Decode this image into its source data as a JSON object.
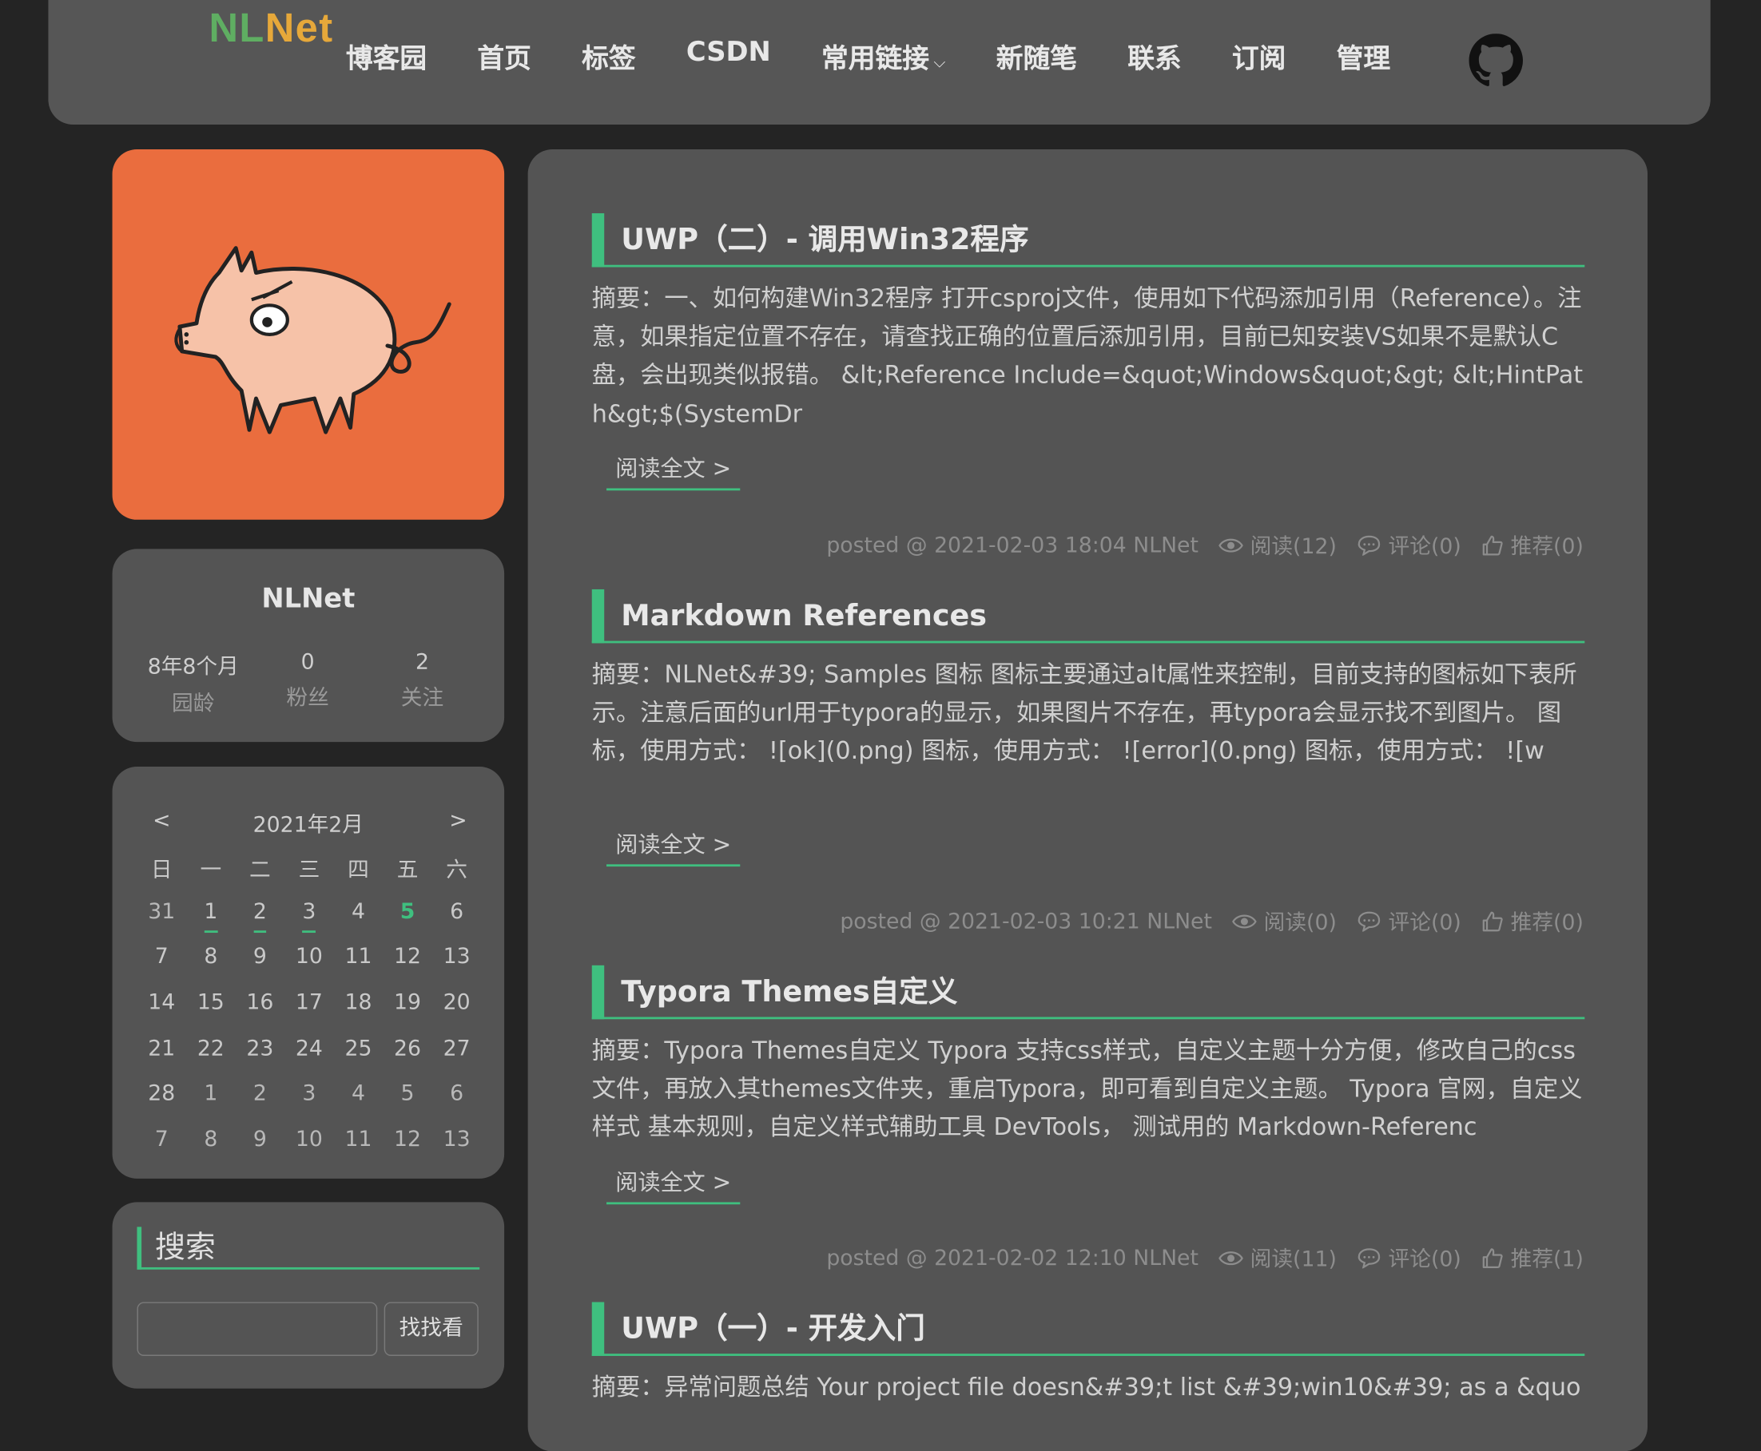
{
  "header": {
    "logo_part1": "NL",
    "logo_part2": "Net",
    "nav": [
      {
        "label": "博客园"
      },
      {
        "label": "首页"
      },
      {
        "label": "标签"
      },
      {
        "label": "CSDN"
      },
      {
        "label": "常用链接"
      },
      {
        "label": "新随笔"
      },
      {
        "label": "联系"
      },
      {
        "label": "订阅"
      },
      {
        "label": "管理"
      }
    ]
  },
  "profile": {
    "name": "NLNet",
    "stats": [
      {
        "value": "8年8个月",
        "label": "园龄"
      },
      {
        "value": "0",
        "label": "粉丝"
      },
      {
        "value": "2",
        "label": "关注"
      }
    ]
  },
  "calendar": {
    "prev": "<",
    "next": ">",
    "title": "2021年2月",
    "weekdays": [
      "日",
      "一",
      "二",
      "三",
      "四",
      "五",
      "六"
    ],
    "rows": [
      [
        "31",
        "1",
        "2",
        "3",
        "4",
        "5",
        "6"
      ],
      [
        "7",
        "8",
        "9",
        "10",
        "11",
        "12",
        "13"
      ],
      [
        "14",
        "15",
        "16",
        "17",
        "18",
        "19",
        "20"
      ],
      [
        "21",
        "22",
        "23",
        "24",
        "25",
        "26",
        "27"
      ],
      [
        "28",
        "1",
        "2",
        "3",
        "4",
        "5",
        "6"
      ],
      [
        "7",
        "8",
        "9",
        "10",
        "11",
        "12",
        "13"
      ]
    ]
  },
  "search": {
    "title": "搜索",
    "button": "找找看"
  },
  "posts": [
    {
      "title": "UWP（二）- 调用Win32程序",
      "summary": "摘要：一、如何构建Win32程序 打开csproj文件，使用如下代码添加引用（Reference）。注意，如果指定位置不存在，请查找正确的位置后添加引用，目前已知安装VS如果不是默认C盘，会出现类似报错。 &lt;Reference Include=&quot;Windows&quot;&gt; &lt;HintPath&gt;$(SystemDr",
      "readmore": "阅读全文 >",
      "posted": "posted @ 2021-02-03 18:04 NLNet",
      "reads": "阅读(12)",
      "comments": "评论(0)",
      "likes": "推荐(0)"
    },
    {
      "title": "Markdown References",
      "summary": "摘要：NLNet&#39; Samples 图标 图标主要通过alt属性来控制，目前支持的图标如下表所示。注意后面的url用于typora的显示，如果图片不存在，再typora会显示找不到图片。 图标，使用方式： ![ok](0.png) 图标，使用方式： ![error](0.png) 图标，使用方式： ![w",
      "readmore": "阅读全文 >",
      "posted": "posted @ 2021-02-03 10:21 NLNet",
      "reads": "阅读(0)",
      "comments": "评论(0)",
      "likes": "推荐(0)"
    },
    {
      "title": "Typora Themes自定义",
      "summary": "摘要：Typora Themes自定义 Typora 支持css样式，自定义主题十分方便，修改自己的css文件，再放入其themes文件夹，重启Typora，即可看到自定义主题。 Typora 官网，自定义样式 基本规则，自定义样式辅助工具 DevTools， 测试用的 Markdown-Referenc",
      "readmore": "阅读全文 >",
      "posted": "posted @ 2021-02-02 12:10 NLNet",
      "reads": "阅读(11)",
      "comments": "评论(0)",
      "likes": "推荐(1)"
    },
    {
      "title": "UWP（一）- 开发入门",
      "summary": "摘要：异常问题总结 Your project file doesn&#39;t list &#39;win10&#39; as a &quot;Ru"
    }
  ]
}
